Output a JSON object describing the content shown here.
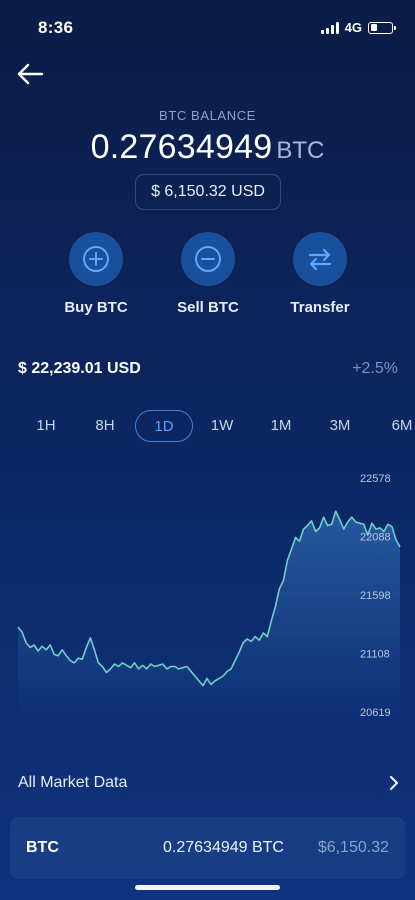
{
  "status_bar": {
    "time": "8:36",
    "network": "4G",
    "battery_level": 0.3
  },
  "balance": {
    "label": "BTC BALANCE",
    "amount": "0.27634949",
    "unit": "BTC",
    "usd_value": "$ 6,150.32 USD"
  },
  "actions": [
    {
      "label": "Buy BTC",
      "icon": "plus-circle-icon"
    },
    {
      "label": "Sell BTC",
      "icon": "minus-circle-icon"
    },
    {
      "label": "Transfer",
      "icon": "transfer-arrows-icon"
    }
  ],
  "price": {
    "value": "$ 22,239.01 USD",
    "change": "+2.5%"
  },
  "time_ranges": {
    "items": [
      "1H",
      "8H",
      "1D",
      "1W",
      "1M",
      "3M",
      "6M"
    ],
    "selected": "1D"
  },
  "chart_data": {
    "type": "area",
    "y_ticks": [
      "22578",
      "22088",
      "21598",
      "21108",
      "20619"
    ],
    "ylim": [
      20619,
      22578
    ],
    "x": [
      0,
      1,
      2,
      3,
      4,
      5,
      6,
      7,
      8,
      9,
      10,
      11,
      12,
      13,
      14,
      15,
      16,
      17,
      18,
      19,
      20,
      21,
      22,
      23,
      24,
      25,
      26,
      27,
      28,
      29,
      30,
      31,
      32,
      33,
      34,
      35,
      36,
      37,
      38,
      39,
      40,
      41,
      42,
      43,
      44,
      45,
      46,
      47,
      48,
      49,
      50,
      51,
      52,
      53,
      54,
      55,
      56,
      57,
      58,
      59,
      60,
      61,
      62,
      63,
      64,
      65,
      66,
      67,
      68,
      69,
      70,
      71,
      72,
      73,
      74,
      75,
      76,
      77,
      78,
      79,
      80,
      81,
      82,
      83,
      84,
      85,
      86,
      87,
      88,
      89,
      90,
      91,
      92,
      93,
      94,
      95
    ],
    "series": [
      {
        "values": [
          21330,
          21290,
          21200,
          21160,
          21180,
          21130,
          21170,
          21140,
          21180,
          21100,
          21090,
          21140,
          21090,
          21050,
          21030,
          21070,
          21060,
          21160,
          21240,
          21140,
          21030,
          21000,
          20950,
          20980,
          21020,
          21000,
          21030,
          21010,
          20990,
          21030,
          20980,
          21010,
          20980,
          21020,
          21000,
          21010,
          21020,
          20980,
          21000,
          21000,
          20980,
          20990,
          21000,
          20960,
          20920,
          20880,
          20840,
          20900,
          20850,
          20880,
          20900,
          20920,
          20960,
          20980,
          21050,
          21120,
          21200,
          21230,
          21210,
          21250,
          21220,
          21280,
          21250,
          21380,
          21500,
          21650,
          21720,
          21890,
          21980,
          22080,
          22050,
          22150,
          22180,
          22220,
          22130,
          22160,
          22250,
          22180,
          22190,
          22300,
          22230,
          22150,
          22210,
          22250,
          22210,
          22200,
          22190,
          22100,
          22200,
          22150,
          22160,
          22130,
          22190,
          22170,
          22060,
          22000
        ]
      }
    ]
  },
  "market_link": {
    "label": "All Market Data"
  },
  "holding": {
    "symbol": "BTC",
    "amount": "0.27634949 BTC",
    "value": "$6,150.32"
  }
}
